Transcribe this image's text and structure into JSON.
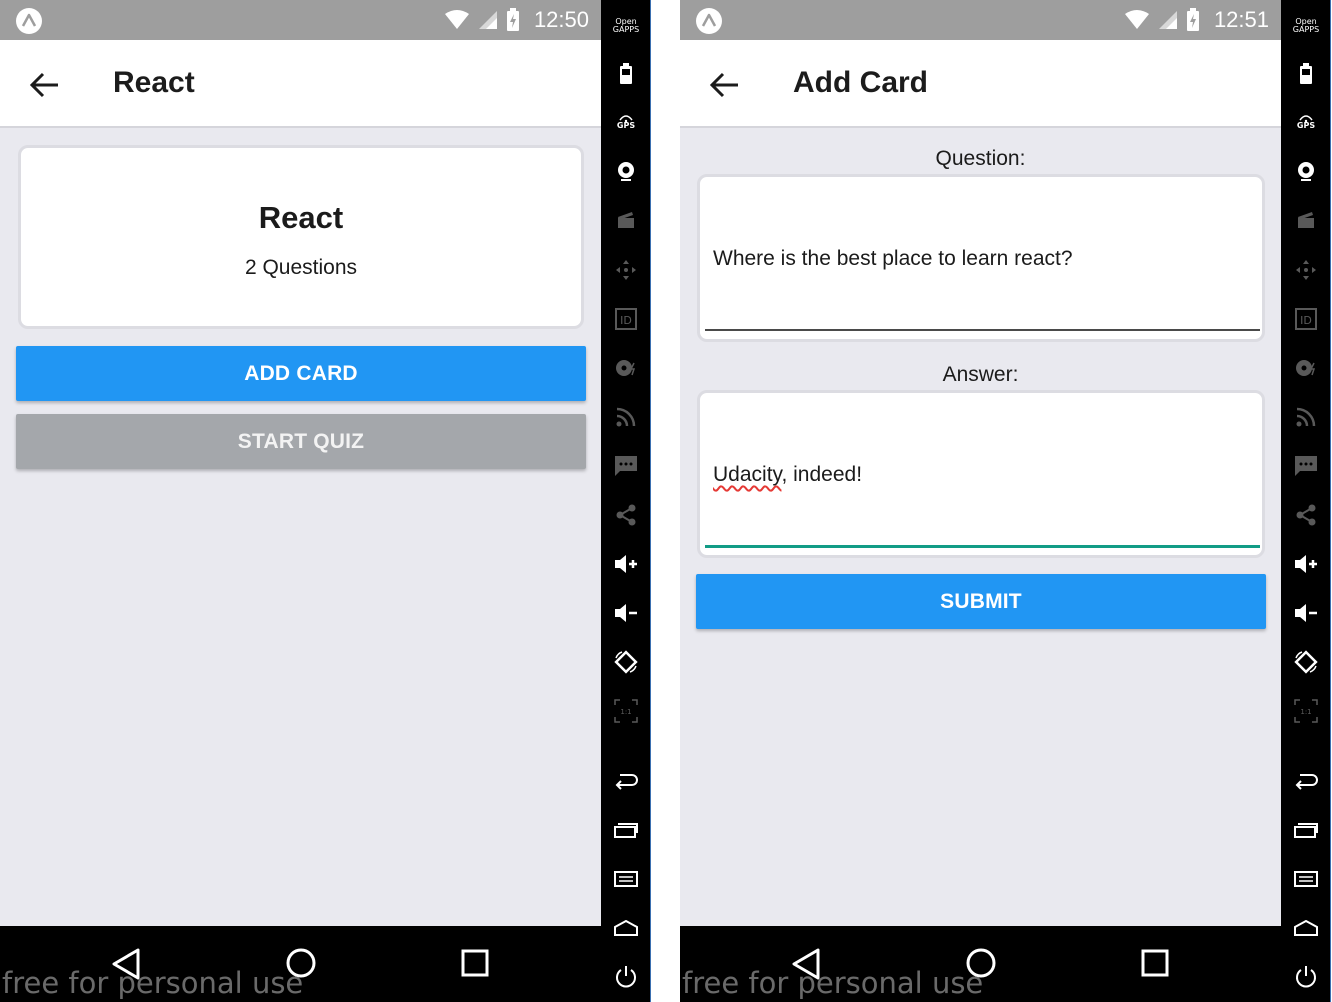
{
  "left": {
    "status_time": "12:50",
    "title": "React",
    "deck": {
      "name": "React",
      "count_text": "2 Questions"
    },
    "add_card_label": "ADD CARD",
    "start_quiz_label": "START QUIZ"
  },
  "right": {
    "status_time": "12:51",
    "title": "Add Card",
    "question_label": "Question:",
    "question_value": "Where is the best place to learn react?",
    "answer_label": "Answer:",
    "answer_misspelled": "Udacity",
    "answer_rest": ", indeed!",
    "submit_label": "SUBMIT"
  },
  "watermark": "free for personal use",
  "sidebar": {
    "open_gapps_line1": "Open",
    "open_gapps_line2": "GAPPS",
    "gps_label": "GPS",
    "id_label": "ID",
    "zoom_label": "1:1"
  },
  "colors": {
    "accent_blue": "#2196f3",
    "disabled_gray": "#a4a7ab",
    "teal_focus": "#129c86",
    "background": "#e9e9ef"
  }
}
